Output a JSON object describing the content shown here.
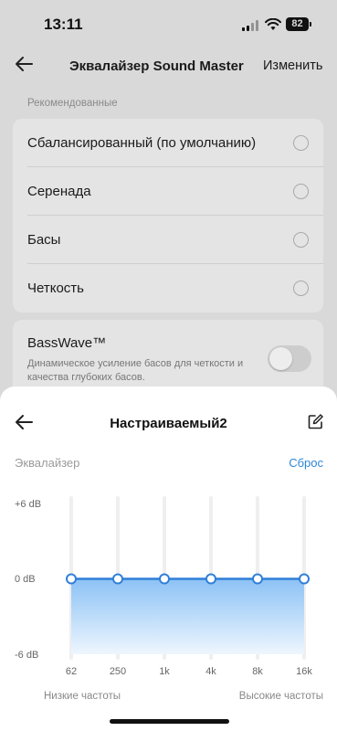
{
  "status_bar": {
    "time": "13:11",
    "battery": "82"
  },
  "header": {
    "title": "Эквалайзер Sound Master",
    "edit_label": "Изменить"
  },
  "presets": {
    "section_label": "Рекомендованные",
    "items": [
      {
        "label": "Сбалансированный (по умолчанию)"
      },
      {
        "label": "Серенада"
      },
      {
        "label": "Басы"
      },
      {
        "label": "Четкость"
      }
    ]
  },
  "basswave": {
    "title": "BassWave™",
    "description": "Динамическое усиление басов для четкости и качества глубоких басов.",
    "enabled": false
  },
  "sheet": {
    "title": "Настраиваемый2",
    "eq_label": "Эквалайзер",
    "reset_label": "Сброс",
    "db_labels": {
      "top": "+6 dB",
      "mid": "0 dB",
      "bottom": "-6 dB"
    },
    "low_label": "Низкие частоты",
    "high_label": "Высокие частоты"
  },
  "chart_data": {
    "type": "line",
    "x": [
      "62",
      "250",
      "1k",
      "4k",
      "8k",
      "16k"
    ],
    "series": [
      {
        "values": [
          0,
          0,
          0,
          0,
          0,
          0
        ]
      }
    ],
    "ylim": [
      -6,
      6
    ],
    "colors": {
      "line": "#2f7fd8",
      "fill_top": "#8cc2f5",
      "fill_bottom": "#eef6fe"
    }
  }
}
